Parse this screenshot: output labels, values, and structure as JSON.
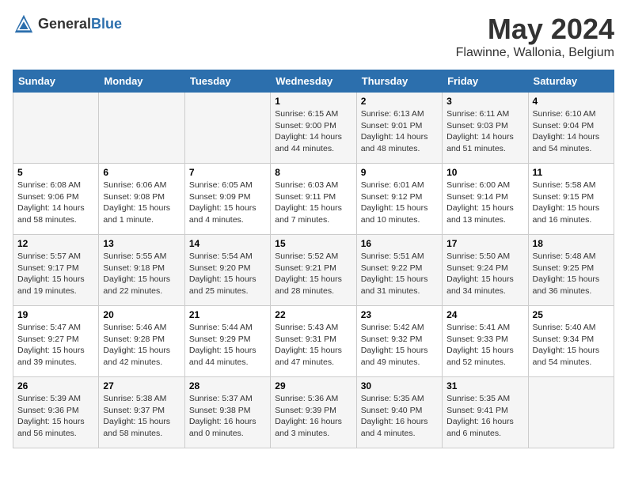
{
  "logo": {
    "general": "General",
    "blue": "Blue"
  },
  "title": "May 2024",
  "subtitle": "Flawinne, Wallonia, Belgium",
  "days_header": [
    "Sunday",
    "Monday",
    "Tuesday",
    "Wednesday",
    "Thursday",
    "Friday",
    "Saturday"
  ],
  "weeks": [
    [
      {
        "day": "",
        "info": ""
      },
      {
        "day": "",
        "info": ""
      },
      {
        "day": "",
        "info": ""
      },
      {
        "day": "1",
        "info": "Sunrise: 6:15 AM\nSunset: 9:00 PM\nDaylight: 14 hours and 44 minutes."
      },
      {
        "day": "2",
        "info": "Sunrise: 6:13 AM\nSunset: 9:01 PM\nDaylight: 14 hours and 48 minutes."
      },
      {
        "day": "3",
        "info": "Sunrise: 6:11 AM\nSunset: 9:03 PM\nDaylight: 14 hours and 51 minutes."
      },
      {
        "day": "4",
        "info": "Sunrise: 6:10 AM\nSunset: 9:04 PM\nDaylight: 14 hours and 54 minutes."
      }
    ],
    [
      {
        "day": "5",
        "info": "Sunrise: 6:08 AM\nSunset: 9:06 PM\nDaylight: 14 hours and 58 minutes."
      },
      {
        "day": "6",
        "info": "Sunrise: 6:06 AM\nSunset: 9:08 PM\nDaylight: 15 hours and 1 minute."
      },
      {
        "day": "7",
        "info": "Sunrise: 6:05 AM\nSunset: 9:09 PM\nDaylight: 15 hours and 4 minutes."
      },
      {
        "day": "8",
        "info": "Sunrise: 6:03 AM\nSunset: 9:11 PM\nDaylight: 15 hours and 7 minutes."
      },
      {
        "day": "9",
        "info": "Sunrise: 6:01 AM\nSunset: 9:12 PM\nDaylight: 15 hours and 10 minutes."
      },
      {
        "day": "10",
        "info": "Sunrise: 6:00 AM\nSunset: 9:14 PM\nDaylight: 15 hours and 13 minutes."
      },
      {
        "day": "11",
        "info": "Sunrise: 5:58 AM\nSunset: 9:15 PM\nDaylight: 15 hours and 16 minutes."
      }
    ],
    [
      {
        "day": "12",
        "info": "Sunrise: 5:57 AM\nSunset: 9:17 PM\nDaylight: 15 hours and 19 minutes."
      },
      {
        "day": "13",
        "info": "Sunrise: 5:55 AM\nSunset: 9:18 PM\nDaylight: 15 hours and 22 minutes."
      },
      {
        "day": "14",
        "info": "Sunrise: 5:54 AM\nSunset: 9:20 PM\nDaylight: 15 hours and 25 minutes."
      },
      {
        "day": "15",
        "info": "Sunrise: 5:52 AM\nSunset: 9:21 PM\nDaylight: 15 hours and 28 minutes."
      },
      {
        "day": "16",
        "info": "Sunrise: 5:51 AM\nSunset: 9:22 PM\nDaylight: 15 hours and 31 minutes."
      },
      {
        "day": "17",
        "info": "Sunrise: 5:50 AM\nSunset: 9:24 PM\nDaylight: 15 hours and 34 minutes."
      },
      {
        "day": "18",
        "info": "Sunrise: 5:48 AM\nSunset: 9:25 PM\nDaylight: 15 hours and 36 minutes."
      }
    ],
    [
      {
        "day": "19",
        "info": "Sunrise: 5:47 AM\nSunset: 9:27 PM\nDaylight: 15 hours and 39 minutes."
      },
      {
        "day": "20",
        "info": "Sunrise: 5:46 AM\nSunset: 9:28 PM\nDaylight: 15 hours and 42 minutes."
      },
      {
        "day": "21",
        "info": "Sunrise: 5:44 AM\nSunset: 9:29 PM\nDaylight: 15 hours and 44 minutes."
      },
      {
        "day": "22",
        "info": "Sunrise: 5:43 AM\nSunset: 9:31 PM\nDaylight: 15 hours and 47 minutes."
      },
      {
        "day": "23",
        "info": "Sunrise: 5:42 AM\nSunset: 9:32 PM\nDaylight: 15 hours and 49 minutes."
      },
      {
        "day": "24",
        "info": "Sunrise: 5:41 AM\nSunset: 9:33 PM\nDaylight: 15 hours and 52 minutes."
      },
      {
        "day": "25",
        "info": "Sunrise: 5:40 AM\nSunset: 9:34 PM\nDaylight: 15 hours and 54 minutes."
      }
    ],
    [
      {
        "day": "26",
        "info": "Sunrise: 5:39 AM\nSunset: 9:36 PM\nDaylight: 15 hours and 56 minutes."
      },
      {
        "day": "27",
        "info": "Sunrise: 5:38 AM\nSunset: 9:37 PM\nDaylight: 15 hours and 58 minutes."
      },
      {
        "day": "28",
        "info": "Sunrise: 5:37 AM\nSunset: 9:38 PM\nDaylight: 16 hours and 0 minutes."
      },
      {
        "day": "29",
        "info": "Sunrise: 5:36 AM\nSunset: 9:39 PM\nDaylight: 16 hours and 3 minutes."
      },
      {
        "day": "30",
        "info": "Sunrise: 5:35 AM\nSunset: 9:40 PM\nDaylight: 16 hours and 4 minutes."
      },
      {
        "day": "31",
        "info": "Sunrise: 5:35 AM\nSunset: 9:41 PM\nDaylight: 16 hours and 6 minutes."
      },
      {
        "day": "",
        "info": ""
      }
    ]
  ]
}
